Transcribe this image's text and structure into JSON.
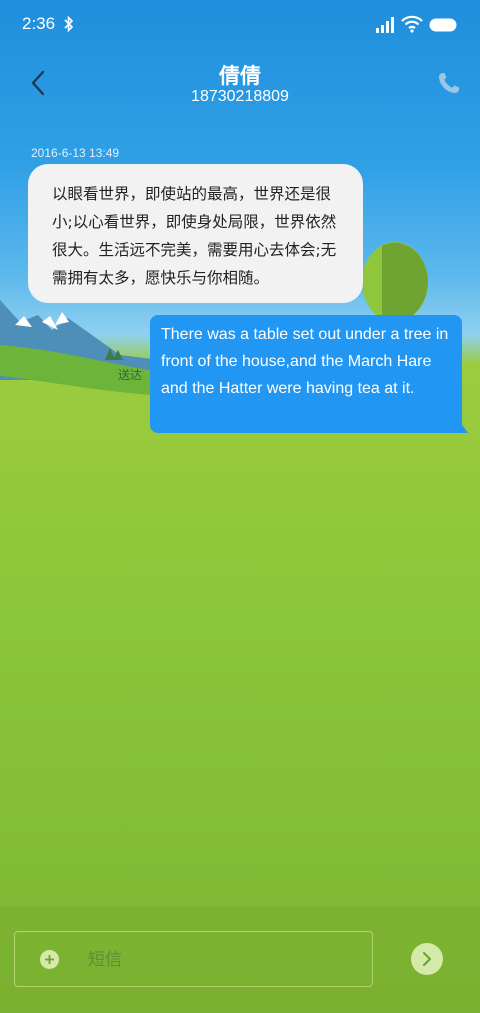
{
  "status_bar": {
    "time": "2:36",
    "icons": [
      "bluetooth-icon",
      "signal-icon",
      "wifi-icon",
      "battery-icon"
    ]
  },
  "header": {
    "contact_name": "倩倩",
    "contact_number": "18730218809",
    "back_icon": "chevron-left-icon",
    "call_icon": "phone-icon"
  },
  "conversation": {
    "timestamp": "2016-6-13 13:49",
    "incoming_message": "以眼看世界，即使站的最高，世界还是很小;以心看世界，即使身处局限，世界依然很大。生活远不完美，需要用心去体会;无需拥有太多，愿快乐与你相随。",
    "outgoing_message": "There was a table set out under a tree in front of the house,and the March Hare and the Hatter were having tea at it.",
    "delivery_status": "送达"
  },
  "composer": {
    "placeholder": "短信",
    "add_icon": "plus-circle-icon",
    "send_icon": "send-arrow-icon"
  },
  "colors": {
    "sky": "#2f9fe6",
    "grass": "#8cc63a",
    "outgoing_bubble": "#2196f3",
    "incoming_bubble": "#f2f2f2"
  }
}
